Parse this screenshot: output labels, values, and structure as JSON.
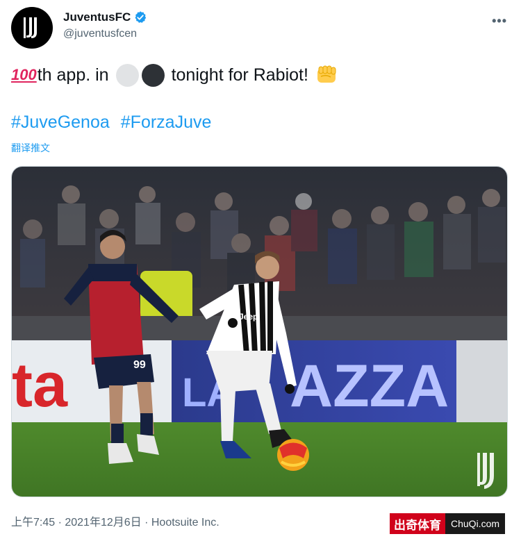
{
  "account": {
    "display_name": "JuventusFC",
    "handle": "@juventusfcen"
  },
  "tweet": {
    "emoji_100": "100",
    "text_part1": "th app. in",
    "text_part2": "tonight for Rabiot!",
    "hashtags": [
      "#JuveGenoa",
      "#ForzaJuve"
    ],
    "translate_label": "翻译推文"
  },
  "meta": {
    "timestamp": "上午7:45 · 2021年12月6日",
    "separator": " · ",
    "source": "Hootsuite Inc."
  },
  "watermark": {
    "left_text": "出奇体育",
    "right_text": "ChuQi.com"
  },
  "photo_text": {
    "ad_left": "ta",
    "ad_main": "AZZA",
    "ad_prefix": "LA",
    "player1_number": "99",
    "sponsor": "Jeep"
  },
  "icons": {
    "avatar": "juventus-logo-icon",
    "verified": "verified-badge-icon",
    "more": "more-options-icon",
    "fist": "oncoming-fist-icon"
  },
  "colors": {
    "link": "#1d9bf0",
    "verified": "#1d9bf0",
    "text": "#0f1419",
    "secondary": "#536471"
  }
}
